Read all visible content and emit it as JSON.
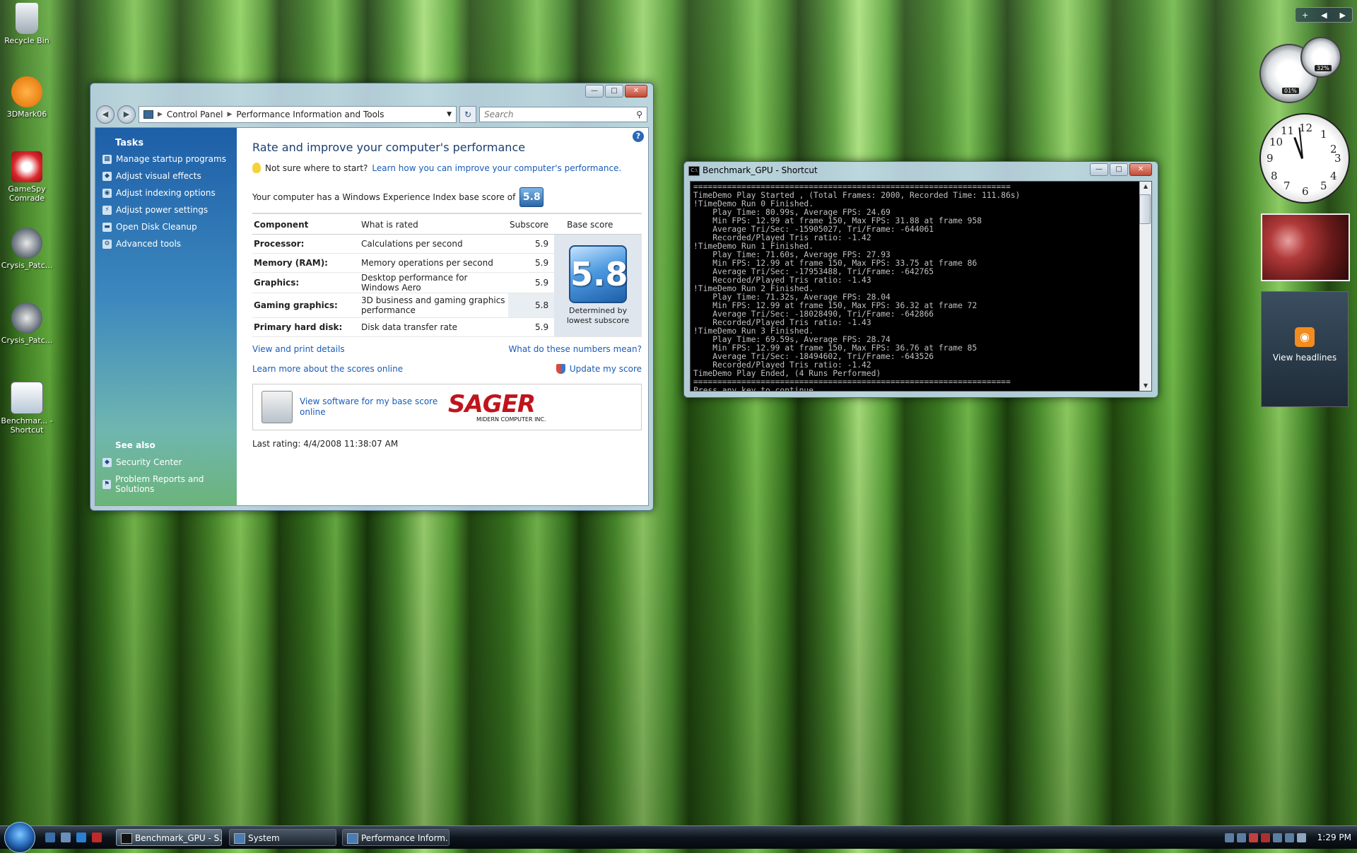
{
  "desktop_icons": [
    {
      "label": "Recycle Bin",
      "icon": "recycle-bin-icon"
    },
    {
      "label": "3DMark06",
      "icon": "3dmark-icon"
    },
    {
      "label": "GameSpy Comrade",
      "icon": "gamespy-icon"
    },
    {
      "label": "Crysis_Patc...",
      "icon": "crysis-icon"
    },
    {
      "label": "Crysis_Patc...",
      "icon": "crysis-icon"
    },
    {
      "label": "Benchmar... - Shortcut",
      "icon": "benchmark-icon"
    }
  ],
  "cp_window": {
    "breadcrumb": [
      "Control Panel",
      "Performance Information and Tools"
    ],
    "search_placeholder": "Search",
    "tasks_heading": "Tasks",
    "tasks": [
      "Manage startup programs",
      "Adjust visual effects",
      "Adjust indexing options",
      "Adjust power settings",
      "Open Disk Cleanup",
      "Advanced tools"
    ],
    "see_also_heading": "See also",
    "see_also": [
      "Security Center",
      "Problem Reports and Solutions"
    ],
    "title": "Rate and improve your computer's performance",
    "tip_prefix": "Not sure where to start?",
    "tip_link": "Learn how you can improve your computer's performance.",
    "wei_text": "Your computer has a Windows Experience Index base score of",
    "base_score": "5.8",
    "headers": {
      "component": "Component",
      "what": "What is rated",
      "subscore": "Subscore",
      "base": "Base score"
    },
    "rows": [
      {
        "component": "Processor:",
        "what": "Calculations per second",
        "subscore": "5.9"
      },
      {
        "component": "Memory (RAM):",
        "what": "Memory operations per second",
        "subscore": "5.9"
      },
      {
        "component": "Graphics:",
        "what": "Desktop performance for Windows Aero",
        "subscore": "5.9"
      },
      {
        "component": "Gaming graphics:",
        "what": "3D business and gaming graphics performance",
        "subscore": "5.8"
      },
      {
        "component": "Primary hard disk:",
        "what": "Disk data transfer rate",
        "subscore": "5.9"
      }
    ],
    "base_note": "Determined by lowest subscore",
    "view_print": "View and print details",
    "what_mean": "What do these numbers mean?",
    "learn_more": "Learn more about the scores online",
    "update_score": "Update my score",
    "software_link": "View software for my base score online",
    "oem_logo": "SAGER",
    "oem_tagline": "MIDERN COMPUTER INC.",
    "last_rating": "Last rating: 4/4/2008 11:38:07 AM"
  },
  "console": {
    "title": "Benchmark_GPU - Shortcut",
    "lines": [
      "==================================================================",
      "TimeDemo Play Started , (Total Frames: 2000, Recorded Time: 111.86s)",
      "!TimeDemo Run 0 Finished.",
      "    Play Time: 80.99s, Average FPS: 24.69",
      "    Min FPS: 12.99 at frame 150, Max FPS: 31.88 at frame 958",
      "    Average Tri/Sec: -15905027, Tri/Frame: -644061",
      "    Recorded/Played Tris ratio: -1.42",
      "!TimeDemo Run 1 Finished.",
      "    Play Time: 71.60s, Average FPS: 27.93",
      "    Min FPS: 12.99 at frame 150, Max FPS: 33.75 at frame 86",
      "    Average Tri/Sec: -17953488, Tri/Frame: -642765",
      "    Recorded/Played Tris ratio: -1.43",
      "!TimeDemo Run 2 Finished.",
      "    Play Time: 71.32s, Average FPS: 28.04",
      "    Min FPS: 12.99 at frame 150, Max FPS: 36.32 at frame 72",
      "    Average Tri/Sec: -18028490, Tri/Frame: -642866",
      "    Recorded/Played Tris ratio: -1.43",
      "!TimeDemo Run 3 Finished.",
      "    Play Time: 69.59s, Average FPS: 28.74",
      "    Min FPS: 12.99 at frame 150, Max FPS: 36.76 at frame 85",
      "    Average Tri/Sec: -18494602, Tri/Frame: -643526",
      "    Recorded/Played Tris ratio: -1.42",
      "TimeDemo Play Ended, (4 Runs Performed)",
      "==================================================================",
      "Press any key to continue . . ."
    ]
  },
  "gadgets": {
    "cpu_percent": "01%",
    "mem_percent": "32%",
    "clock_numbers": [
      "12",
      "1",
      "2",
      "3",
      "4",
      "5",
      "6",
      "7",
      "8",
      "9",
      "10",
      "11"
    ],
    "feed_label": "View headlines"
  },
  "taskbar": {
    "buttons": [
      "Benchmark_GPU - S...",
      "System",
      "Performance Inform..."
    ],
    "time": "1:29 PM"
  }
}
